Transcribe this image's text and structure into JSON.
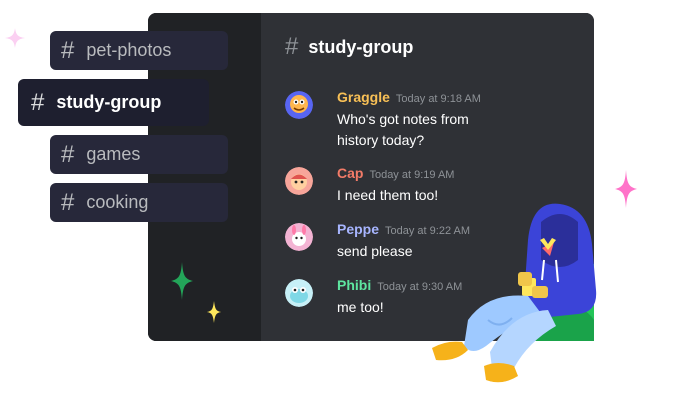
{
  "channels": [
    {
      "label": "pet-photos",
      "active": false
    },
    {
      "label": "study-group",
      "active": true
    },
    {
      "label": "games",
      "active": false
    },
    {
      "label": "cooking",
      "active": false
    }
  ],
  "header": {
    "channel": "study-group"
  },
  "messages": [
    {
      "author": "Graggle",
      "time": "Today at 9:18 AM",
      "text_line1": "Who's got notes from",
      "text_line2": "history today?",
      "color": "#f8c056"
    },
    {
      "author": "Cap",
      "time": "Today at 9:19 AM",
      "text": "I need them too!",
      "color": "#f37b68"
    },
    {
      "author": "Peppe",
      "time": "Today at 9:22 AM",
      "text": "send please",
      "color": "#a7b5ff"
    },
    {
      "author": "Phibi",
      "time": "Today at 9:30 AM",
      "text": "me too!",
      "color": "#5ee6a0"
    }
  ],
  "icons": {
    "hash": "#"
  },
  "colors": {
    "pink_sparkle": "#ff73c9",
    "green_sparkle": "#22c55e",
    "yellow_sparkle": "#fee75c",
    "blurple": "#4752f1"
  }
}
